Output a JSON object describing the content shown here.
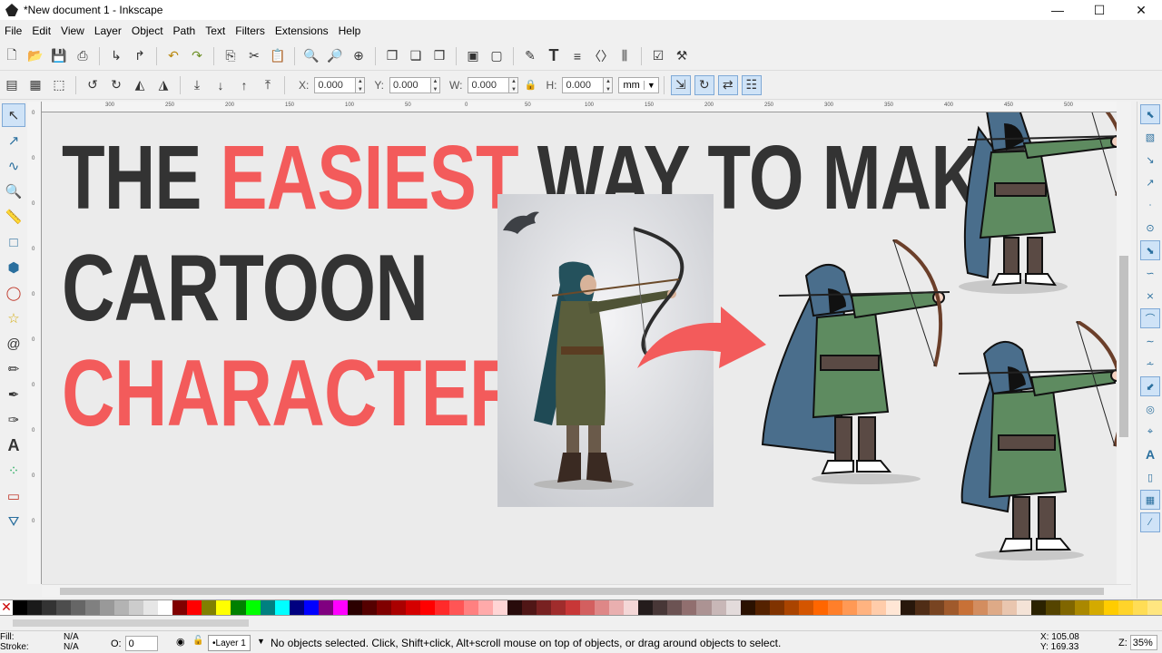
{
  "window": {
    "title": "*New document 1 - Inkscape",
    "controls": [
      "—",
      "☐",
      "✕"
    ]
  },
  "menu": [
    "File",
    "Edit",
    "View",
    "Layer",
    "Object",
    "Path",
    "Text",
    "Filters",
    "Extensions",
    "Help"
  ],
  "toolctl": {
    "x_label": "X:",
    "x_value": "0.000",
    "y_label": "Y:",
    "y_value": "0.000",
    "w_label": "W:",
    "w_value": "0.000",
    "h_label": "H:",
    "h_value": "0.000",
    "unit": "mm"
  },
  "ruler": {
    "h_ticks": [
      "300",
      "250",
      "200",
      "150",
      "100",
      "50",
      "0",
      "50",
      "100",
      "150",
      "200",
      "250",
      "300",
      "350",
      "400",
      "450",
      "500"
    ],
    "v_ticks": [
      "0",
      "0",
      "0",
      "0",
      "0",
      "0",
      "0",
      "0",
      "0",
      "0"
    ]
  },
  "headline": {
    "line1_dark_a": "THE",
    "line1_red": "EASIEST",
    "line1_dark_b": "WAY TO MAKE",
    "line2": "CARTOON",
    "line3": "CHARACTERS"
  },
  "colors": {
    "dark": "#333333",
    "red": "#f35b5b",
    "selection": "#cfe3f7"
  },
  "palette": [
    "#000000",
    "#1a1a1a",
    "#333333",
    "#4d4d4d",
    "#666666",
    "#808080",
    "#999999",
    "#b3b3b3",
    "#cccccc",
    "#e6e6e6",
    "#ffffff",
    "#800000",
    "#ff0000",
    "#808000",
    "#ffff00",
    "#008000",
    "#00ff00",
    "#008080",
    "#00ffff",
    "#000080",
    "#0000ff",
    "#800080",
    "#ff00ff",
    "#2b0000",
    "#550000",
    "#800000",
    "#aa0000",
    "#d40000",
    "#ff0000",
    "#ff2a2a",
    "#ff5555",
    "#ff8080",
    "#ffaaaa",
    "#ffd5d5",
    "#280b0b",
    "#501616",
    "#782121",
    "#a02c2c",
    "#c83737",
    "#d35f5f",
    "#de8787",
    "#e9afaf",
    "#f4d7d7",
    "#241c1c",
    "#483737",
    "#6c5353",
    "#916f6f",
    "#ac9393",
    "#c8b7b7",
    "#e3dbdb",
    "#2b1100",
    "#552200",
    "#803300",
    "#aa4400",
    "#d45500",
    "#ff6600",
    "#ff7f2a",
    "#ff9955",
    "#ffb380",
    "#ffccaa",
    "#ffe6d5",
    "#28170b",
    "#502d16",
    "#784421",
    "#a05a2c",
    "#c87137",
    "#d38d5f",
    "#deaa87",
    "#e9c6af",
    "#f4e3d7",
    "#2b2200",
    "#554400",
    "#806600",
    "#aa8800",
    "#d4aa00",
    "#ffcc00",
    "#ffd42a",
    "#ffdd55",
    "#ffe680"
  ],
  "status": {
    "fill_label": "Fill:",
    "stroke_label": "Stroke:",
    "fill_value": "N/A",
    "stroke_value": "N/A",
    "opacity_label": "O:",
    "opacity_value": "0",
    "layer": "•Layer 1",
    "message": "No objects selected. Click, Shift+click, Alt+scroll mouse on top of objects, or drag around objects to select.",
    "x": "X: 105.08",
    "y": "Y: 169.33",
    "zoom_label": "Z:",
    "zoom_value": "35%"
  }
}
